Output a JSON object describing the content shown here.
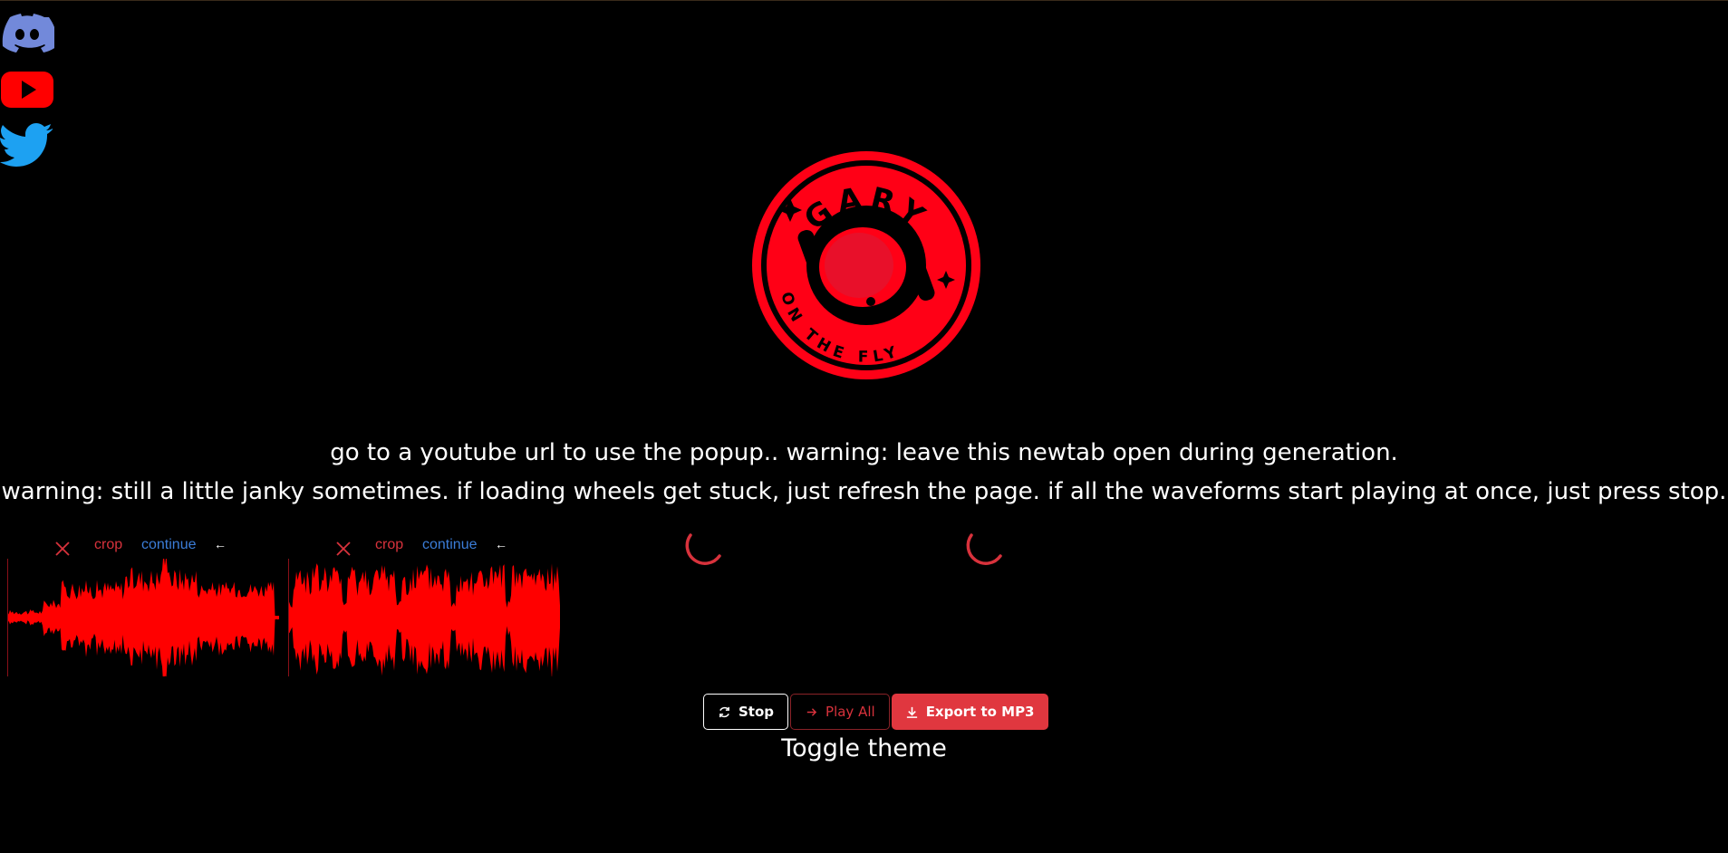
{
  "social": {
    "discord_icon": "discord-icon",
    "youtube_icon": "youtube-icon",
    "twitter_icon": "twitter-icon",
    "colors": {
      "discord": "#7289da",
      "youtube": "#ff0000",
      "twitter": "#1da1f2"
    }
  },
  "logo": {
    "top_text": "GARY",
    "bottom_text": "ON THE FLY",
    "color": "#ff0016"
  },
  "messages": {
    "line1": "go to a youtube url to use the popup.. warning: leave this newtab open during generation.",
    "line2": "warning: still a little janky sometimes. if loading wheels get stuck, just refresh the page. if all the waveforms start playing at once, just press stop."
  },
  "cards": [
    {
      "close_icon": "close-icon",
      "crop_label": "crop",
      "continue_label": "continue",
      "back_icon": "arrow-left-icon"
    },
    {
      "close_icon": "close-icon",
      "crop_label": "crop",
      "continue_label": "continue",
      "back_icon": "arrow-left-icon"
    }
  ],
  "back_glyph": "←",
  "actions": {
    "stop_label": "Stop",
    "play_all_label": "Play All",
    "export_label": "Export to MP3"
  },
  "toggle_theme_label": "Toggle theme",
  "accent_color": "#e0373f"
}
